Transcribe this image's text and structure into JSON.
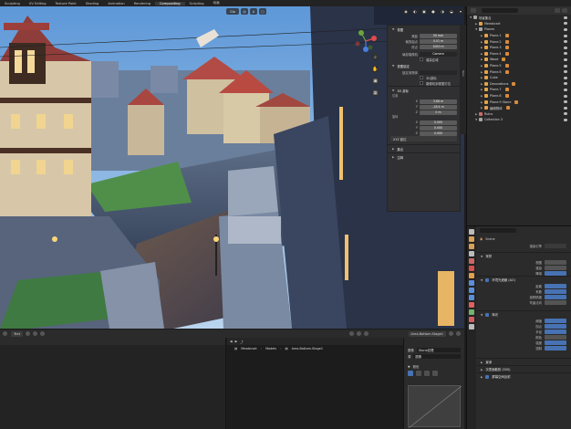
{
  "topbar": {
    "tabs": [
      {
        "label": "Sculpting",
        "active": false
      },
      {
        "label": "UV Editing",
        "active": false
      },
      {
        "label": "Texture Paint",
        "active": false
      },
      {
        "label": "Shading",
        "active": false
      },
      {
        "label": "Animation",
        "active": false
      },
      {
        "label": "Rendering",
        "active": false
      },
      {
        "label": "Compositing",
        "active": true
      },
      {
        "label": "Scripting",
        "active": false
      },
      {
        "label": "动画",
        "active": false
      }
    ]
  },
  "viewport_header": {
    "orientation": "Glo",
    "pivot_icon": "pivot-icon",
    "snap_icon": "magnet-icon"
  },
  "npanel": {
    "sec_view": "视图",
    "focal_label": "焦距",
    "focal_value": "50 mm",
    "clip_start_label": "裁剪起点",
    "clip_start_value": "0.01 m",
    "clip_end_label": "终点",
    "clip_end_value": "1000 m",
    "local_camera_label": "局部摄像机",
    "local_camera_value": "Camera",
    "render_region_label": "渲染区域",
    "view_lock_title": "视图锁定",
    "lock_to_object_label": "锁定到物体",
    "lock_3d_cursor_label": "3D游标",
    "lock_camera_view_label": "摄像机到视图方位",
    "sec_cursor": "3D 游标",
    "location_label": "位置",
    "x_value": "3.66 m",
    "y_value": "-18.4 m",
    "z_value": "0 m",
    "rotation_label": "旋转",
    "rx_value": "0.000",
    "ry_value": "0.000",
    "rz_value": "0.000",
    "rotation_mode": "XYZ 欧拉",
    "sec_collections": "集合",
    "sec_annotations": "注释"
  },
  "vertical_tab": "Item",
  "bottombar": {
    "mode": "Text",
    "path_label": "Area.Bottom.Stage1"
  },
  "filebrowser": {
    "path": [
      "Mewbicart",
      "Models",
      "Area.Bottom.Stage1"
    ]
  },
  "texpane": {
    "image_label": "图像",
    "image_name": "Stone纹理",
    "source_label": "源",
    "source_value": "图像",
    "color_label": "颜色",
    "mapping_label": "映射",
    "settings_label": "设置"
  },
  "outliner": {
    "items": [
      {
        "label": "场景集合",
        "indent": 0,
        "kind": "col",
        "tag": false
      },
      {
        "label": "Mewbicart",
        "indent": 1,
        "kind": "obj",
        "tag": false
      },
      {
        "label": "Planes",
        "indent": 1,
        "kind": "col",
        "tag": false
      },
      {
        "label": "Plane.1",
        "indent": 2,
        "kind": "obj",
        "tag": true
      },
      {
        "label": "Plane.2",
        "indent": 2,
        "kind": "obj",
        "tag": true
      },
      {
        "label": "Plane.3",
        "indent": 2,
        "kind": "obj",
        "tag": true
      },
      {
        "label": "Plane.4",
        "indent": 2,
        "kind": "obj",
        "tag": true
      },
      {
        "label": "Wood",
        "indent": 2,
        "kind": "obj",
        "tag": true
      },
      {
        "label": "Plane.5",
        "indent": 2,
        "kind": "obj",
        "tag": true
      },
      {
        "label": "Plane.6",
        "indent": 2,
        "kind": "obj",
        "tag": true
      },
      {
        "label": "Cube",
        "indent": 2,
        "kind": "obj",
        "tag": false
      },
      {
        "label": "Decorations",
        "indent": 2,
        "kind": "obj",
        "tag": true
      },
      {
        "label": "Plane.7",
        "indent": 2,
        "kind": "obj",
        "tag": true
      },
      {
        "label": "Plane.8",
        "indent": 2,
        "kind": "obj",
        "tag": true
      },
      {
        "label": "Plane.9 Stone",
        "indent": 2,
        "kind": "obj",
        "tag": true
      },
      {
        "label": "编辑物体",
        "indent": 2,
        "kind": "obj",
        "tag": true
      },
      {
        "label": "Ruins",
        "indent": 1,
        "kind": "emp",
        "tag": false
      },
      {
        "label": "Collection 3",
        "indent": 1,
        "kind": "col",
        "tag": false
      }
    ]
  },
  "properties": {
    "scene_label": "Scene",
    "render_engine_label": "渲染引擎",
    "sec_sampling": "采样",
    "viewport_label": "视图",
    "render_label": "渲染",
    "denoise_label": "降噪",
    "sec_ao": "环境光遮蔽 (AO)",
    "distance_label": "距离",
    "factor_label": "系数",
    "trace_label": "追踪精度",
    "bent_label": "弯曲法向",
    "sec_bloom": "辉光",
    "threshold_label": "阈值",
    "knee_label": "拐点",
    "radius_label": "半径",
    "color_label": "颜色",
    "intensity_label": "强度",
    "clamp_label": "钳制",
    "sec_dof": "景深",
    "sec_sss": "次表面散射 (SSS)",
    "sec_ssr": "屏幕空间反射"
  },
  "colors": {
    "accent": "#4772b3",
    "sky": "#7fb4e8",
    "orange_tag": "#d68b3c"
  }
}
